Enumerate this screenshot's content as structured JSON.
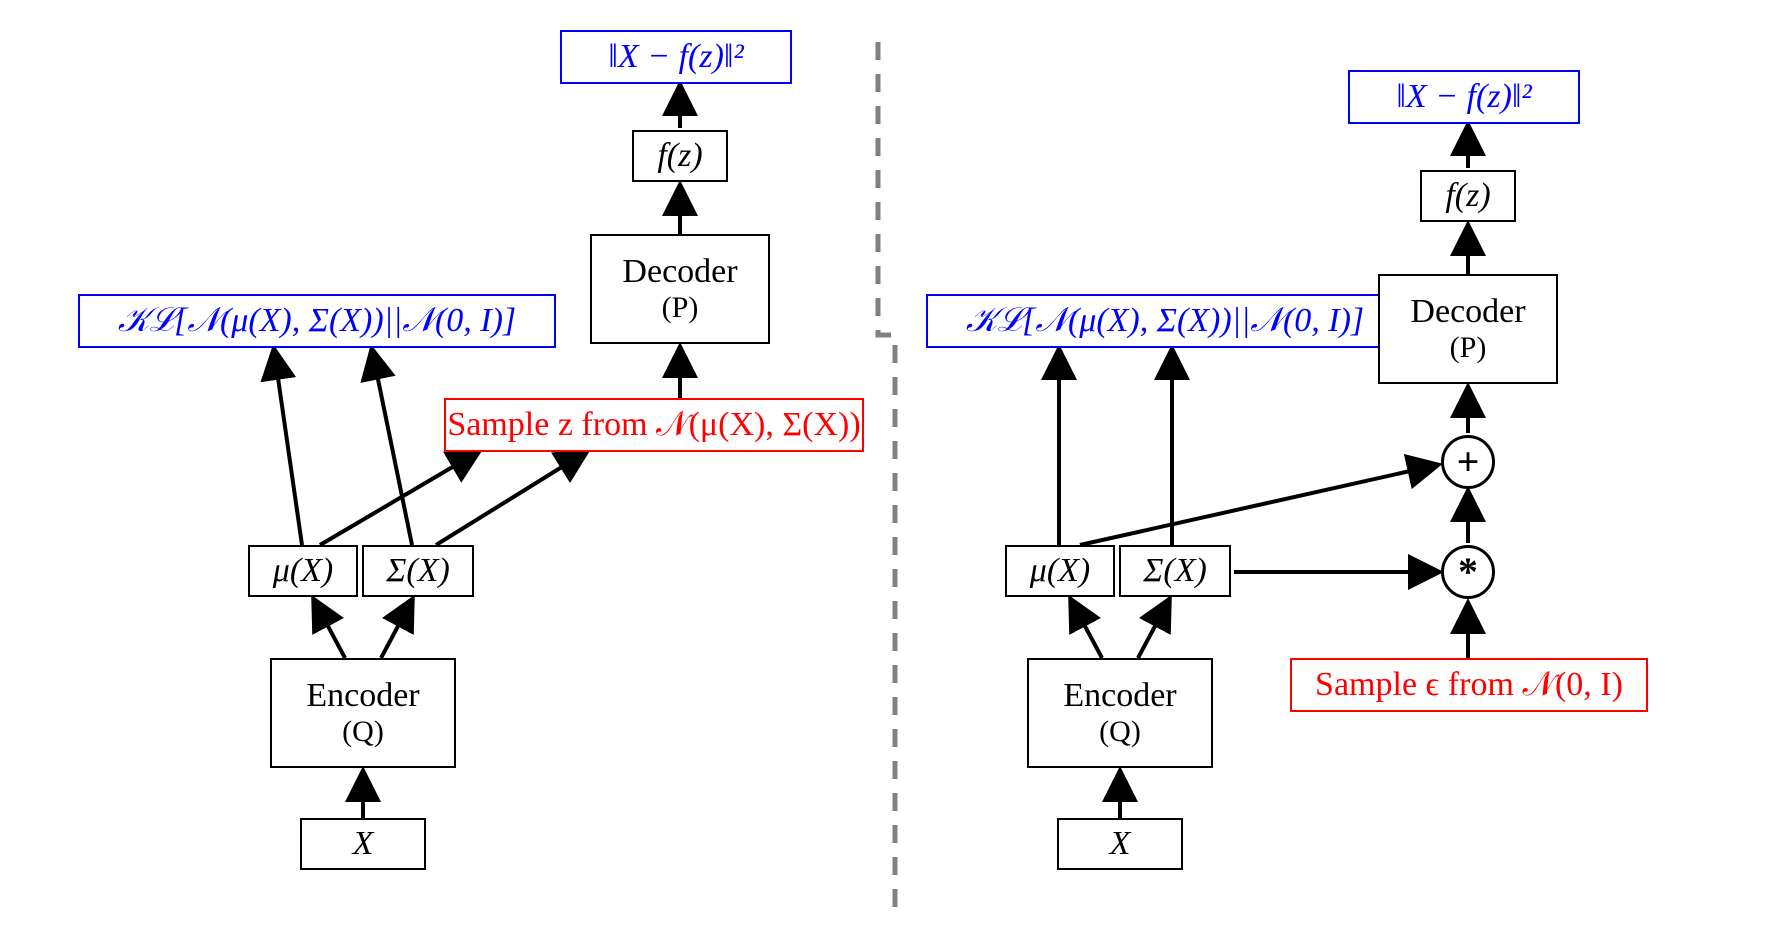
{
  "left": {
    "input": "X",
    "encoder_line1": "Encoder",
    "encoder_line2": "(Q)",
    "mu": "μ(X)",
    "sigma": "Σ(X)",
    "kl": "𝒦ℒ[𝒩(μ(X), Σ(X))||𝒩(0, I)]",
    "sample": "Sample z from 𝒩(μ(X), Σ(X))",
    "decoder_line1": "Decoder",
    "decoder_line2": "(P)",
    "fz": "f(z)",
    "loss": "‖X − f(z)‖²"
  },
  "right": {
    "input": "X",
    "encoder_line1": "Encoder",
    "encoder_line2": "(Q)",
    "mu": "μ(X)",
    "sigma": "Σ(X)",
    "kl": "𝒦ℒ[𝒩(μ(X), Σ(X))||𝒩(0, I)]",
    "sample": "Sample ϵ from 𝒩(0, I)",
    "mul": "*",
    "add": "+",
    "decoder_line1": "Decoder",
    "decoder_line2": "(P)",
    "fz": "f(z)",
    "loss": "‖X − f(z)‖²"
  }
}
